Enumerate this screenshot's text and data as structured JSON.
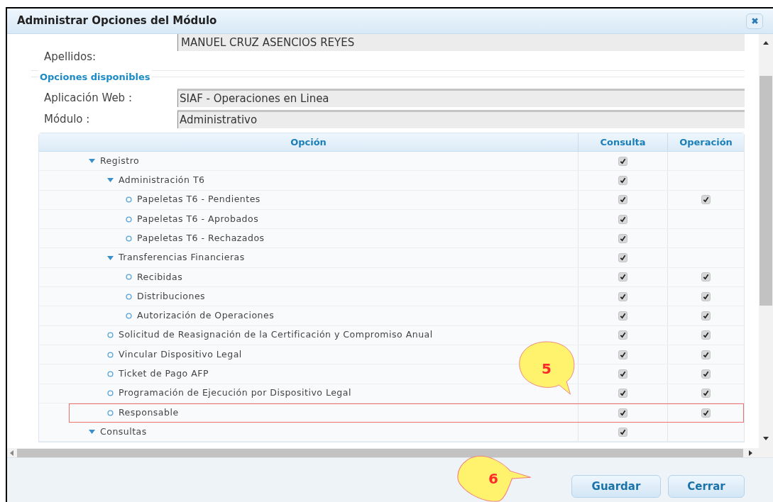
{
  "window": {
    "title": "Administrar Opciones del Módulo"
  },
  "user": {
    "label": "Apellidos:",
    "value": "MANUEL CRUZ ASENCIOS REYES"
  },
  "options_section": {
    "legend": "Opciones disponibles",
    "fields": [
      {
        "label": "Aplicación Web :",
        "value": "SIAF - Operaciones en Linea"
      },
      {
        "label": "Módulo :",
        "value": "Administrativo"
      }
    ]
  },
  "table": {
    "columns": [
      "Opción",
      "Consulta",
      "Operación"
    ],
    "rows": [
      {
        "label": "Registro",
        "expanded": true,
        "consulta": true,
        "operacion": false,
        "highlighted": false,
        "children": [
          {
            "label": "Administración T6",
            "expanded": true,
            "consulta": true,
            "operacion": false,
            "highlighted": false,
            "children": [
              {
                "label": "Papeletas T6 - Pendientes",
                "consulta": true,
                "operacion": true,
                "highlighted": false
              },
              {
                "label": "Papeletas T6 - Aprobados",
                "consulta": true,
                "operacion": false,
                "highlighted": false
              },
              {
                "label": "Papeletas T6 - Rechazados",
                "consulta": true,
                "operacion": false,
                "highlighted": false
              }
            ]
          },
          {
            "label": "Transferencias Financieras",
            "expanded": true,
            "consulta": true,
            "operacion": false,
            "highlighted": false,
            "children": [
              {
                "label": "Recibidas",
                "consulta": true,
                "operacion": true,
                "highlighted": false
              },
              {
                "label": "Distribuciones",
                "consulta": true,
                "operacion": true,
                "highlighted": false
              },
              {
                "label": "Autorización de Operaciones",
                "consulta": true,
                "operacion": true,
                "highlighted": false
              }
            ]
          },
          {
            "label": "Solicitud de Reasignación de la Certificación y Compromiso Anual",
            "consulta": true,
            "operacion": true,
            "highlighted": false
          },
          {
            "label": "Vincular Dispositivo Legal",
            "consulta": true,
            "operacion": true,
            "highlighted": false
          },
          {
            "label": "Ticket de Pago AFP",
            "consulta": true,
            "operacion": true,
            "highlighted": false
          },
          {
            "label": "Programación de Ejecución por Dispositivo Legal",
            "consulta": true,
            "operacion": true,
            "highlighted": false
          },
          {
            "label": "Responsable",
            "consulta": true,
            "operacion": true,
            "highlighted": true
          }
        ]
      },
      {
        "label": "Consultas",
        "expanded": true,
        "consulta": true,
        "operacion": false,
        "highlighted": false
      }
    ]
  },
  "callouts": [
    {
      "text": "5"
    },
    {
      "text": "6"
    }
  ],
  "buttons": [
    "Guardar",
    "Cerrar"
  ]
}
